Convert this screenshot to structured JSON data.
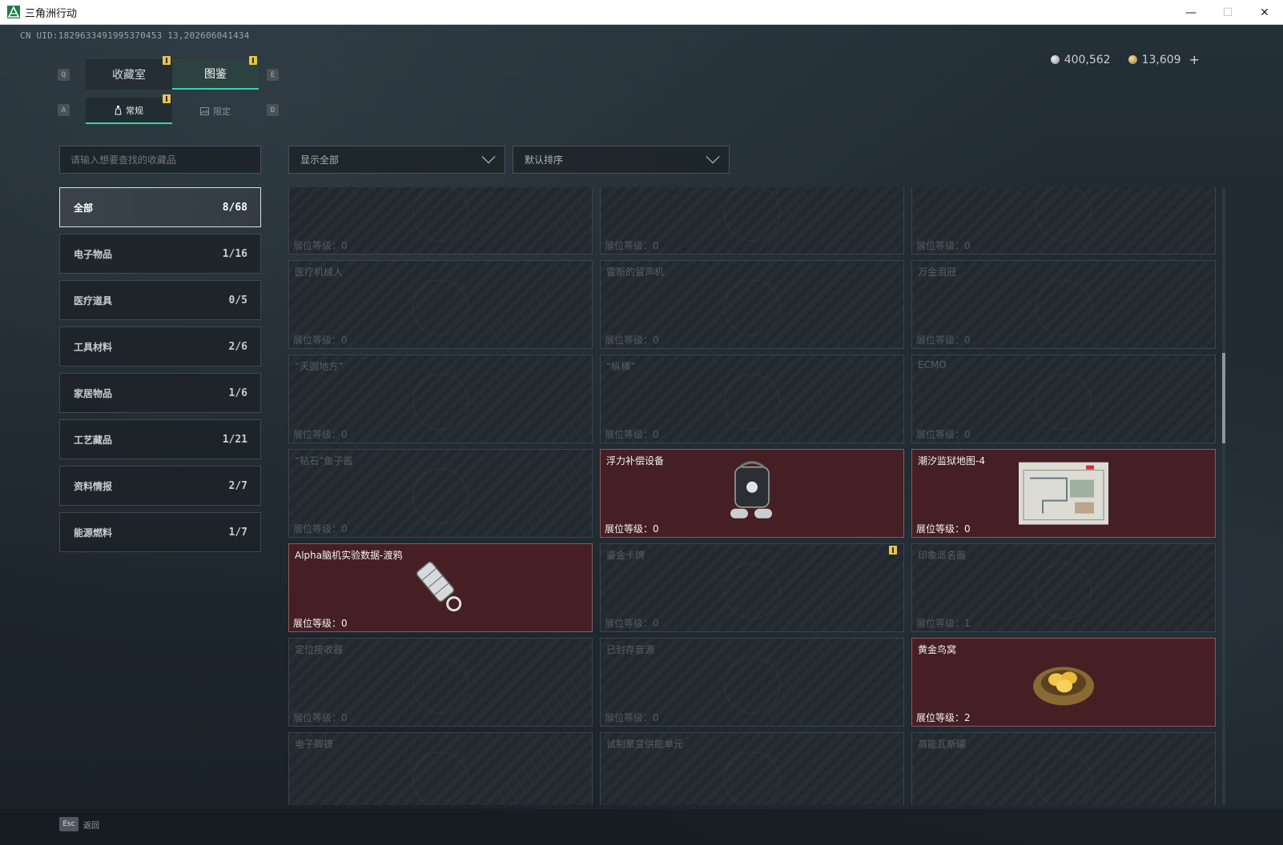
{
  "window": {
    "title": "三角洲行动",
    "minimize": "—",
    "maximize": "☐",
    "close": "✕"
  },
  "uid": "CN UID:1829633491995370453 13,202606041434",
  "currency": {
    "silver": "400,562",
    "gold": "13,609",
    "plus": "+"
  },
  "key_hints": {
    "prev_main": "Q",
    "next_main": "E",
    "prev_sub": "A",
    "next_sub": "D"
  },
  "main_tabs": [
    {
      "label": "收藏室"
    },
    {
      "label": "图鉴"
    }
  ],
  "sub_tabs": [
    {
      "label": "常规"
    },
    {
      "label": "限定"
    }
  ],
  "search": {
    "placeholder": "请输入想要查找的收藏品"
  },
  "filter": {
    "selected": "显示全部"
  },
  "sort": {
    "selected": "默认排序"
  },
  "categories": [
    {
      "label": "全部",
      "count": "8/68"
    },
    {
      "label": "电子物品",
      "count": "1/16"
    },
    {
      "label": "医疗道具",
      "count": "0/5"
    },
    {
      "label": "工具材料",
      "count": "2/6"
    },
    {
      "label": "家居物品",
      "count": "1/6"
    },
    {
      "label": "工艺藏品",
      "count": "1/21"
    },
    {
      "label": "资料情报",
      "count": "2/7"
    },
    {
      "label": "能源燃料",
      "count": "1/7"
    }
  ],
  "level_prefix": "展位等级：",
  "cards": [
    {
      "name": "",
      "level": "展位等级：0",
      "owned": false
    },
    {
      "name": "",
      "level": "展位等级：0",
      "owned": false
    },
    {
      "name": "",
      "level": "展位等级：0",
      "owned": false
    },
    {
      "name": "医疗机械人",
      "level": "展位等级：0",
      "owned": false
    },
    {
      "name": "雷斯的留声机",
      "level": "展位等级：0",
      "owned": false
    },
    {
      "name": "万金泪冠",
      "level": "展位等级：0",
      "owned": false
    },
    {
      "name": "“天圆地方”",
      "level": "展位等级：0",
      "owned": false
    },
    {
      "name": "“纵横”",
      "level": "展位等级：0",
      "owned": false
    },
    {
      "name": "ECMO",
      "level": "展位等级：0",
      "owned": false
    },
    {
      "name": "“钻石”鱼子酱",
      "level": "展位等级：0",
      "owned": false
    },
    {
      "name": "浮力补偿设备",
      "level": "展位等级：0",
      "owned": true
    },
    {
      "name": "潮汐监狱地图-4",
      "level": "展位等级：0",
      "owned": true
    },
    {
      "name": "Alpha脑机实验数据-渡鸦",
      "level": "展位等级：0",
      "owned": true
    },
    {
      "name": "鎏金卡牌",
      "level": "展位等级：0",
      "owned": false,
      "new": true
    },
    {
      "name": "印象派名画",
      "level": "展位等级：1",
      "owned": false
    },
    {
      "name": "定位接收器",
      "level": "展位等级：0",
      "owned": false
    },
    {
      "name": "已封存音源",
      "level": "展位等级：0",
      "owned": false
    },
    {
      "name": "黄金鸟窝",
      "level": "展位等级：2",
      "owned": true
    },
    {
      "name": "电子脚镣",
      "level": "",
      "owned": false
    },
    {
      "name": "试制聚变供能单元",
      "level": "",
      "owned": false
    },
    {
      "name": "高能瓦斯罐",
      "level": "",
      "owned": false
    }
  ],
  "footer": {
    "esc_key": "Esc",
    "back_label": "返回"
  },
  "colors": {
    "accent": "#2fd9a3",
    "owned_card": "#451f24",
    "badge": "#e8c548"
  }
}
